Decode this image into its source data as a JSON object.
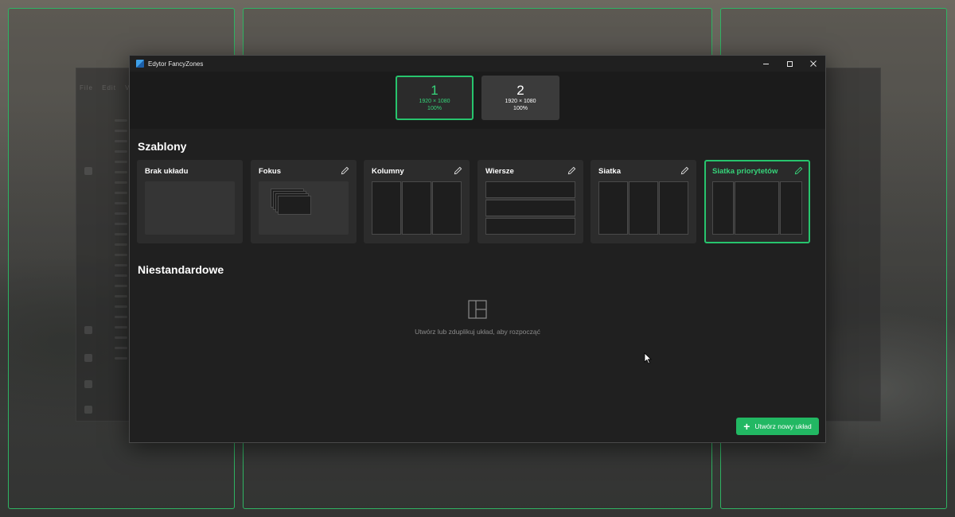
{
  "window": {
    "title": "Edytor FancyZones"
  },
  "monitors": [
    {
      "number": "1",
      "resolution": "1920 × 1080",
      "scale": "100%",
      "selected": true
    },
    {
      "number": "2",
      "resolution": "1920 × 1080",
      "scale": "100%",
      "selected": false
    }
  ],
  "templates": {
    "section_title": "Szablony",
    "items": [
      {
        "label": "Brak układu",
        "editable": false,
        "preview": "none"
      },
      {
        "label": "Fokus",
        "editable": true,
        "preview": "focus"
      },
      {
        "label": "Kolumny",
        "editable": true,
        "preview": "columns"
      },
      {
        "label": "Wiersze",
        "editable": true,
        "preview": "rows"
      },
      {
        "label": "Siatka",
        "editable": true,
        "preview": "grid"
      },
      {
        "label": "Siatka priorytetów",
        "editable": true,
        "preview": "priority-grid",
        "selected": true
      }
    ]
  },
  "custom": {
    "section_title": "Niestandardowe",
    "empty_message": "Utwórz lub zduplikuj układ, aby rozpocząć"
  },
  "actions": {
    "create_label": "Utwórz nowy układ"
  },
  "colors": {
    "accent": "#27c46d",
    "zone_border": "#2fb463",
    "window_bg": "#202020"
  },
  "background": {
    "menu": [
      "File",
      "Edit",
      "View"
    ]
  }
}
